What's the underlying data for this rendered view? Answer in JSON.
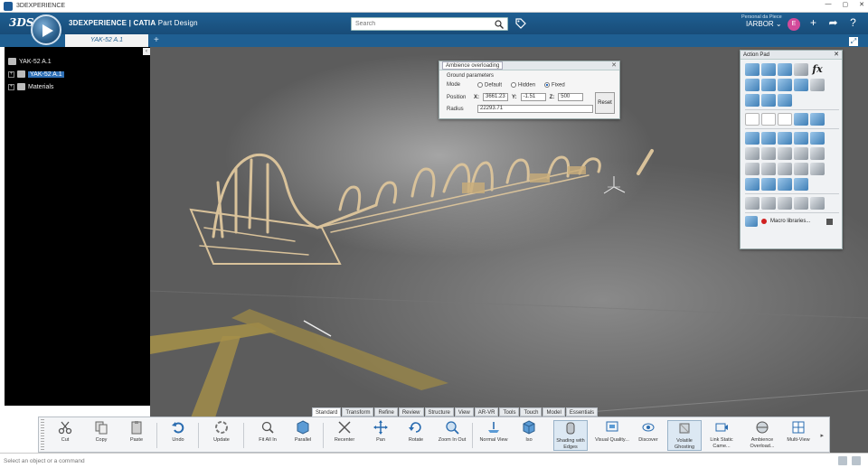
{
  "window": {
    "title": "3DEXPERIENCE",
    "minimize": "—",
    "maximize": "▢",
    "close": "✕"
  },
  "topbar": {
    "logo": "3DS",
    "app_brand": "3DEXPERIENCE | CATIA",
    "app_module": "Part Design",
    "search_placeholder": "Search",
    "collab_label": "Personal da Piece",
    "collab_value": "IARBOR ⌄",
    "avatar_initial": "E"
  },
  "tabs": {
    "active": "YAK-52 A.1",
    "add": "+"
  },
  "tree": {
    "collapse": "‹",
    "items": [
      {
        "label": "YAK-52 A.1"
      },
      {
        "label": "YAK-52 A.1",
        "selected": true
      },
      {
        "label": "Materials"
      }
    ]
  },
  "ambience": {
    "title": "Ambience overloading",
    "section": "Ground parameters",
    "mode_label": "Mode",
    "modes": [
      "Default",
      "Hidden",
      "Fixed"
    ],
    "selected_mode": "Fixed",
    "position_label": "Position",
    "x_label": "X:",
    "x": "3661.23",
    "y_label": "Y:",
    "y": "-1.51",
    "z_label": "Z:",
    "z": "500",
    "radius_label": "Radius",
    "radius": "22293.71",
    "reset": "Reset"
  },
  "action_pad": {
    "title": "Action Pad",
    "macro_label": "Macro libraries..."
  },
  "command_tabs": [
    "Standard",
    "Transform",
    "Refine",
    "Review",
    "Structure",
    "View",
    "AR-VR",
    "Tools",
    "Touch",
    "Model",
    "Essentials"
  ],
  "active_command_tab": "Standard",
  "tools": [
    {
      "label": "Cut",
      "icon": "scissors-icon"
    },
    {
      "label": "Copy",
      "icon": "copy-icon"
    },
    {
      "label": "Paste",
      "icon": "paste-icon"
    },
    {
      "label": "Undo",
      "icon": "undo-icon"
    },
    {
      "label": "Update",
      "icon": "update-icon"
    },
    {
      "label": "Fit All In",
      "icon": "fit-all-icon"
    },
    {
      "label": "Parallel",
      "icon": "parallel-icon"
    },
    {
      "label": "Recenter",
      "icon": "recenter-icon"
    },
    {
      "label": "Pan",
      "icon": "pan-icon"
    },
    {
      "label": "Rotate",
      "icon": "rotate-icon"
    },
    {
      "label": "Zoom In Out",
      "icon": "zoom-icon"
    },
    {
      "label": "Normal View",
      "icon": "normal-view-icon"
    },
    {
      "label": "Iso",
      "icon": "iso-icon"
    },
    {
      "label": "Shading with Edges",
      "icon": "shading-edges-icon"
    },
    {
      "label": "Visual Quality...",
      "icon": "visual-quality-icon"
    },
    {
      "label": "Discover",
      "icon": "discover-icon"
    },
    {
      "label": "Volatile Ghosting",
      "icon": "ghosting-icon"
    },
    {
      "label": "Link Static Came...",
      "icon": "link-camera-icon"
    },
    {
      "label": "Ambience Overload...",
      "icon": "ambience-icon"
    },
    {
      "label": "Multi-View",
      "icon": "multi-view-icon"
    }
  ],
  "status": {
    "placeholder": "Select an object or a command"
  },
  "colors": {
    "brand_blue": "#1f5f92",
    "tree_bg": "#000000",
    "selection": "#2e6fb5"
  }
}
